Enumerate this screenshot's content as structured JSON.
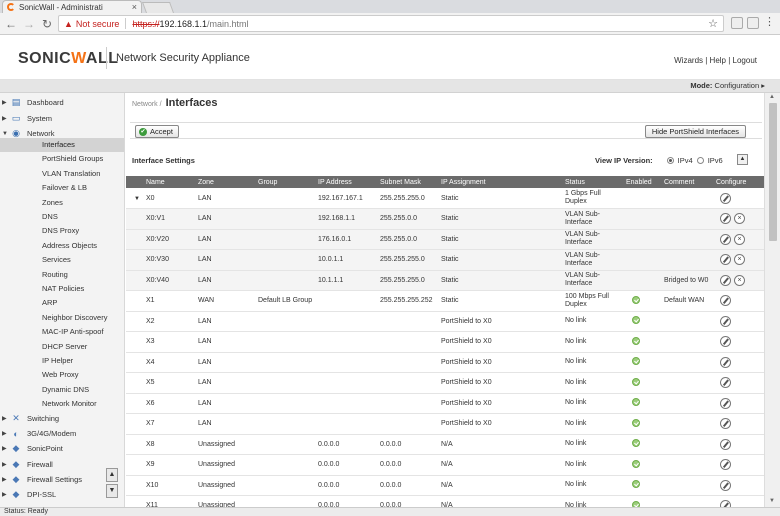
{
  "browser": {
    "tab_title": "SonicWall - Administrati",
    "tab_close": "×",
    "url_warning": "Not secure",
    "url_protocol": "https://",
    "url_host": "192.168.1.1",
    "url_path": "/main.html",
    "menu_glyph": "⋮"
  },
  "header": {
    "logo_left": "SONIC",
    "logo_w": "W",
    "logo_right": "ALL",
    "app_title": "Network Security Appliance",
    "links": "Wizards  |  Help  |  Logout"
  },
  "modebar": {
    "label": "Mode:",
    "value": "Configuration ▸"
  },
  "sidebar": {
    "top": [
      {
        "label": "Dashboard",
        "icon": "dashboard-icon"
      },
      {
        "label": "System",
        "icon": "monitor-icon"
      },
      {
        "label": "Network",
        "icon": "network-icon"
      }
    ],
    "network_sub": [
      "Interfaces",
      "PortShield Groups",
      "VLAN Translation",
      "Failover & LB",
      "Zones",
      "DNS",
      "DNS Proxy",
      "Address Objects",
      "Services",
      "Routing",
      "NAT Policies",
      "ARP",
      "Neighbor Discovery",
      "MAC-IP Anti-spoof",
      "DHCP Server",
      "IP Helper",
      "Web Proxy",
      "Dynamic DNS",
      "Network Monitor"
    ],
    "bottom": [
      {
        "label": "Switching",
        "icon": "switching-icon"
      },
      {
        "label": "3G/4G/Modem",
        "icon": "modem-icon"
      },
      {
        "label": "SonicPoint",
        "icon": "sonicpoint-icon"
      },
      {
        "label": "Firewall",
        "icon": "firewall-icon"
      },
      {
        "label": "Firewall Settings",
        "icon": "firewall-settings-icon"
      },
      {
        "label": "DPI-SSL",
        "icon": "dpi-ssl-icon"
      }
    ]
  },
  "page": {
    "breadcrumb_parent": "Network /",
    "title": "Interfaces",
    "accept_label": "Accept",
    "hide_portshield_label": "Hide PortShield Interfaces",
    "settings_title": "Interface Settings",
    "ip_version_label": "View IP Version:",
    "ipv4_label": "IPv4",
    "ipv6_label": "IPv6"
  },
  "table": {
    "headers": [
      "Name",
      "Zone",
      "Group",
      "IP Address",
      "Subnet Mask",
      "IP Assignment",
      "Status",
      "Enabled",
      "Comment",
      "Configure"
    ],
    "rows": [
      {
        "name": "X0",
        "zone": "LAN",
        "group": "",
        "ip": "192.167.167.1",
        "mask": "255.255.255.0",
        "assign": "Static",
        "status": "1 Gbps Full Duplex",
        "enabled": false,
        "comment": "",
        "del": false,
        "sub": false,
        "expand": true
      },
      {
        "name": "X0:V1",
        "zone": "LAN",
        "group": "",
        "ip": "192.168.1.1",
        "mask": "255.255.0.0",
        "assign": "Static",
        "status": "VLAN Sub-Interface",
        "enabled": false,
        "comment": "",
        "del": true,
        "sub": true,
        "expand": false
      },
      {
        "name": "X0:V20",
        "zone": "LAN",
        "group": "",
        "ip": "176.16.0.1",
        "mask": "255.255.0.0",
        "assign": "Static",
        "status": "VLAN Sub-Interface",
        "enabled": false,
        "comment": "",
        "del": true,
        "sub": true,
        "expand": false
      },
      {
        "name": "X0:V30",
        "zone": "LAN",
        "group": "",
        "ip": "10.0.1.1",
        "mask": "255.255.255.0",
        "assign": "Static",
        "status": "VLAN Sub-Interface",
        "enabled": false,
        "comment": "",
        "del": true,
        "sub": true,
        "expand": false
      },
      {
        "name": "X0:V40",
        "zone": "LAN",
        "group": "",
        "ip": "10.1.1.1",
        "mask": "255.255.255.0",
        "assign": "Static",
        "status": "VLAN Sub-Interface",
        "enabled": false,
        "comment": "Bridged to W0",
        "del": true,
        "sub": true,
        "expand": false
      },
      {
        "name": "X1",
        "zone": "WAN",
        "group": "Default LB Group",
        "ip": "",
        "mask": "255.255.255.252",
        "assign": "Static",
        "status": "100 Mbps Full Duplex",
        "enabled": true,
        "comment": "Default WAN",
        "del": false,
        "sub": false,
        "expand": false
      },
      {
        "name": "X2",
        "zone": "LAN",
        "group": "",
        "ip": "",
        "mask": "",
        "assign": "PortShield to X0",
        "status": "No link",
        "enabled": true,
        "comment": "",
        "del": false,
        "sub": false,
        "expand": false
      },
      {
        "name": "X3",
        "zone": "LAN",
        "group": "",
        "ip": "",
        "mask": "",
        "assign": "PortShield to X0",
        "status": "No link",
        "enabled": true,
        "comment": "",
        "del": false,
        "sub": false,
        "expand": false
      },
      {
        "name": "X4",
        "zone": "LAN",
        "group": "",
        "ip": "",
        "mask": "",
        "assign": "PortShield to X0",
        "status": "No link",
        "enabled": true,
        "comment": "",
        "del": false,
        "sub": false,
        "expand": false
      },
      {
        "name": "X5",
        "zone": "LAN",
        "group": "",
        "ip": "",
        "mask": "",
        "assign": "PortShield to X0",
        "status": "No link",
        "enabled": true,
        "comment": "",
        "del": false,
        "sub": false,
        "expand": false
      },
      {
        "name": "X6",
        "zone": "LAN",
        "group": "",
        "ip": "",
        "mask": "",
        "assign": "PortShield to X0",
        "status": "No link",
        "enabled": true,
        "comment": "",
        "del": false,
        "sub": false,
        "expand": false
      },
      {
        "name": "X7",
        "zone": "LAN",
        "group": "",
        "ip": "",
        "mask": "",
        "assign": "PortShield to X0",
        "status": "No link",
        "enabled": true,
        "comment": "",
        "del": false,
        "sub": false,
        "expand": false
      },
      {
        "name": "X8",
        "zone": "Unassigned",
        "group": "",
        "ip": "0.0.0.0",
        "mask": "0.0.0.0",
        "assign": "N/A",
        "status": "No link",
        "enabled": true,
        "comment": "",
        "del": false,
        "sub": false,
        "expand": false
      },
      {
        "name": "X9",
        "zone": "Unassigned",
        "group": "",
        "ip": "0.0.0.0",
        "mask": "0.0.0.0",
        "assign": "N/A",
        "status": "No link",
        "enabled": true,
        "comment": "",
        "del": false,
        "sub": false,
        "expand": false
      },
      {
        "name": "X10",
        "zone": "Unassigned",
        "group": "",
        "ip": "0.0.0.0",
        "mask": "0.0.0.0",
        "assign": "N/A",
        "status": "No link",
        "enabled": true,
        "comment": "",
        "del": false,
        "sub": false,
        "expand": false
      },
      {
        "name": "X11",
        "zone": "Unassigned",
        "group": "",
        "ip": "0.0.0.0",
        "mask": "0.0.0.0",
        "assign": "N/A",
        "status": "No link",
        "enabled": true,
        "comment": "",
        "del": false,
        "sub": false,
        "expand": false
      }
    ]
  },
  "status_bar": "Status: Ready",
  "colors": {
    "brand_orange": "#f47216",
    "enabled_green": "#9bcd7a",
    "table_header": "#6b6b6b"
  }
}
